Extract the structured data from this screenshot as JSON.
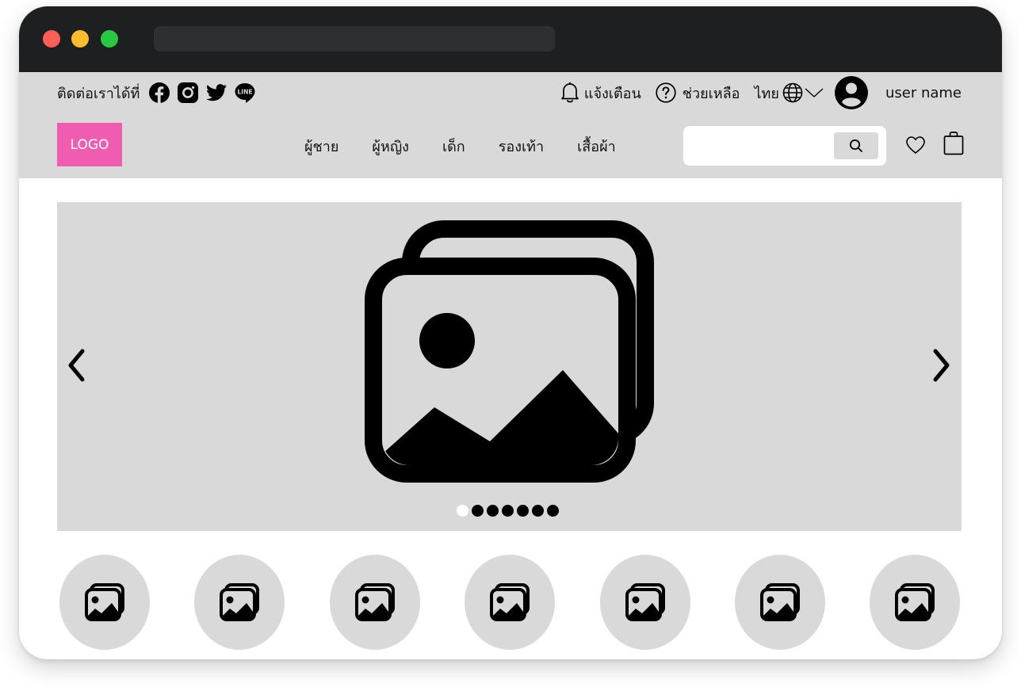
{
  "contact": {
    "label": "ติดต่อเราได้ที่",
    "socials": [
      "facebook-icon",
      "instagram-icon",
      "twitter-icon",
      "line-icon"
    ],
    "line_text": "LINE"
  },
  "utility": {
    "notifications_label": "แจ้งเตือน",
    "help_label": "ช่วยเหลือ",
    "language_label": "ไทย",
    "username": "user name"
  },
  "header": {
    "logo_text": "LOGO",
    "nav_items": [
      "ผู้ชาย",
      "ผู้หญิง",
      "เด็ก",
      "รองเท้า",
      "เสื้อผ้า"
    ],
    "search": {
      "value": "",
      "placeholder": ""
    },
    "icons": [
      "search-icon",
      "heart-icon",
      "shopping-bag-icon"
    ]
  },
  "banner": {
    "slide_count": 7,
    "active_slide": 1,
    "prev_icon": "chevron-left-icon",
    "next_icon": "chevron-right-icon",
    "image_icon": "image-gallery-icon"
  },
  "categories": {
    "count": 7,
    "icon": "image-gallery-icon"
  },
  "colors": {
    "titlebar": "#1e1f21",
    "header_bg": "#d9d9d9",
    "logo_bg": "#f05db0",
    "window_red": "#fe5f57",
    "window_yellow": "#febc2e",
    "window_green": "#28c840"
  }
}
